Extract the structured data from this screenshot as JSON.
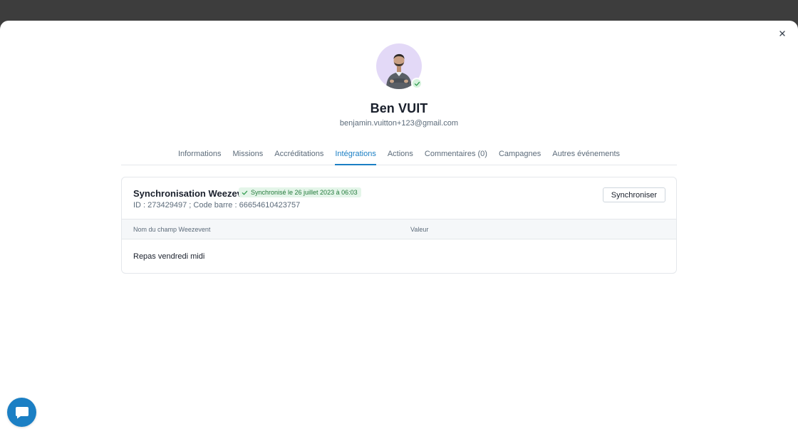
{
  "profile": {
    "name": "Ben VUIT",
    "email": "benjamin.vuitton+123@gmail.com"
  },
  "tabs": [
    {
      "label": "Informations",
      "active": false
    },
    {
      "label": "Missions",
      "active": false
    },
    {
      "label": "Accréditations",
      "active": false
    },
    {
      "label": "Intégrations",
      "active": true
    },
    {
      "label": "Actions",
      "active": false
    },
    {
      "label": "Commentaires (0)",
      "active": false
    },
    {
      "label": "Campagnes",
      "active": false
    },
    {
      "label": "Autres événements",
      "active": false
    }
  ],
  "integration": {
    "title": "Synchronisation Weezevent",
    "status": "Synchronisé le 26 juillet 2023 à 06:03",
    "identifiers": "ID : 273429497 ; Code barre : 66654610423757",
    "sync_button": "Synchroniser",
    "table": {
      "headers": [
        "Nom du champ Weezevent",
        "Valeur"
      ],
      "rows": [
        [
          "Repas vendredi midi",
          ""
        ]
      ]
    }
  },
  "colors": {
    "accent": "#1b7fc4",
    "success_bg": "#e4f5e9",
    "success_text": "#237a3b",
    "avatar_bg": "#e3d9f7",
    "backdrop": "#3d3d3d"
  },
  "icons": {
    "close": "close-icon",
    "verified": "check-icon",
    "status": "check-icon",
    "chat": "chat-bubble-icon"
  }
}
